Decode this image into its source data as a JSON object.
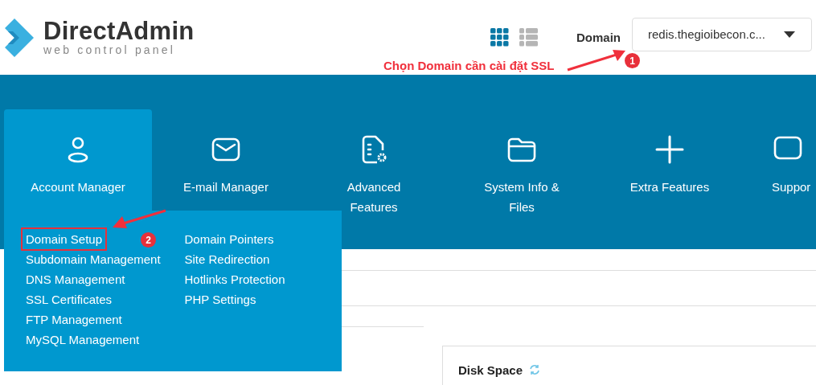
{
  "header": {
    "logo": {
      "name": "DirectAdmin",
      "tagline": "web control panel"
    },
    "view_toggle": [
      {
        "kind": "grid",
        "selected": true
      },
      {
        "kind": "list",
        "selected": false
      }
    ],
    "domain_label": "Domain",
    "domain_select": {
      "value": "redis.thegioibecon.c..."
    }
  },
  "nav": [
    {
      "label": "Account Manager",
      "selected": true
    },
    {
      "label": "E-mail Manager",
      "selected": false
    },
    {
      "label": "Advanced Features",
      "selected": false
    },
    {
      "label": "System Info & Files",
      "selected": false
    },
    {
      "label": "Extra Features",
      "selected": false
    },
    {
      "label": "Suppor",
      "selected": false
    }
  ],
  "dropdown": {
    "columns": [
      [
        {
          "label": "Domain Setup",
          "highlighted": true
        },
        {
          "label": "Subdomain Management",
          "highlighted": false
        },
        {
          "label": "DNS Management",
          "highlighted": false
        },
        {
          "label": "SSL Certificates",
          "highlighted": false
        },
        {
          "label": "FTP Management",
          "highlighted": false
        },
        {
          "label": "MySQL Management",
          "highlighted": false
        }
      ],
      [
        {
          "label": "Domain Pointers",
          "highlighted": false
        },
        {
          "label": "Site Redirection",
          "highlighted": false
        },
        {
          "label": "Hotlinks Protection",
          "highlighted": false
        },
        {
          "label": "PHP Settings",
          "highlighted": false
        }
      ]
    ]
  },
  "annotations": [
    {
      "text": "Chọn Domain cần cài đặt SSL",
      "number": "1"
    },
    {
      "number": "2"
    }
  ],
  "disk_card": {
    "title": "Disk Space"
  }
}
